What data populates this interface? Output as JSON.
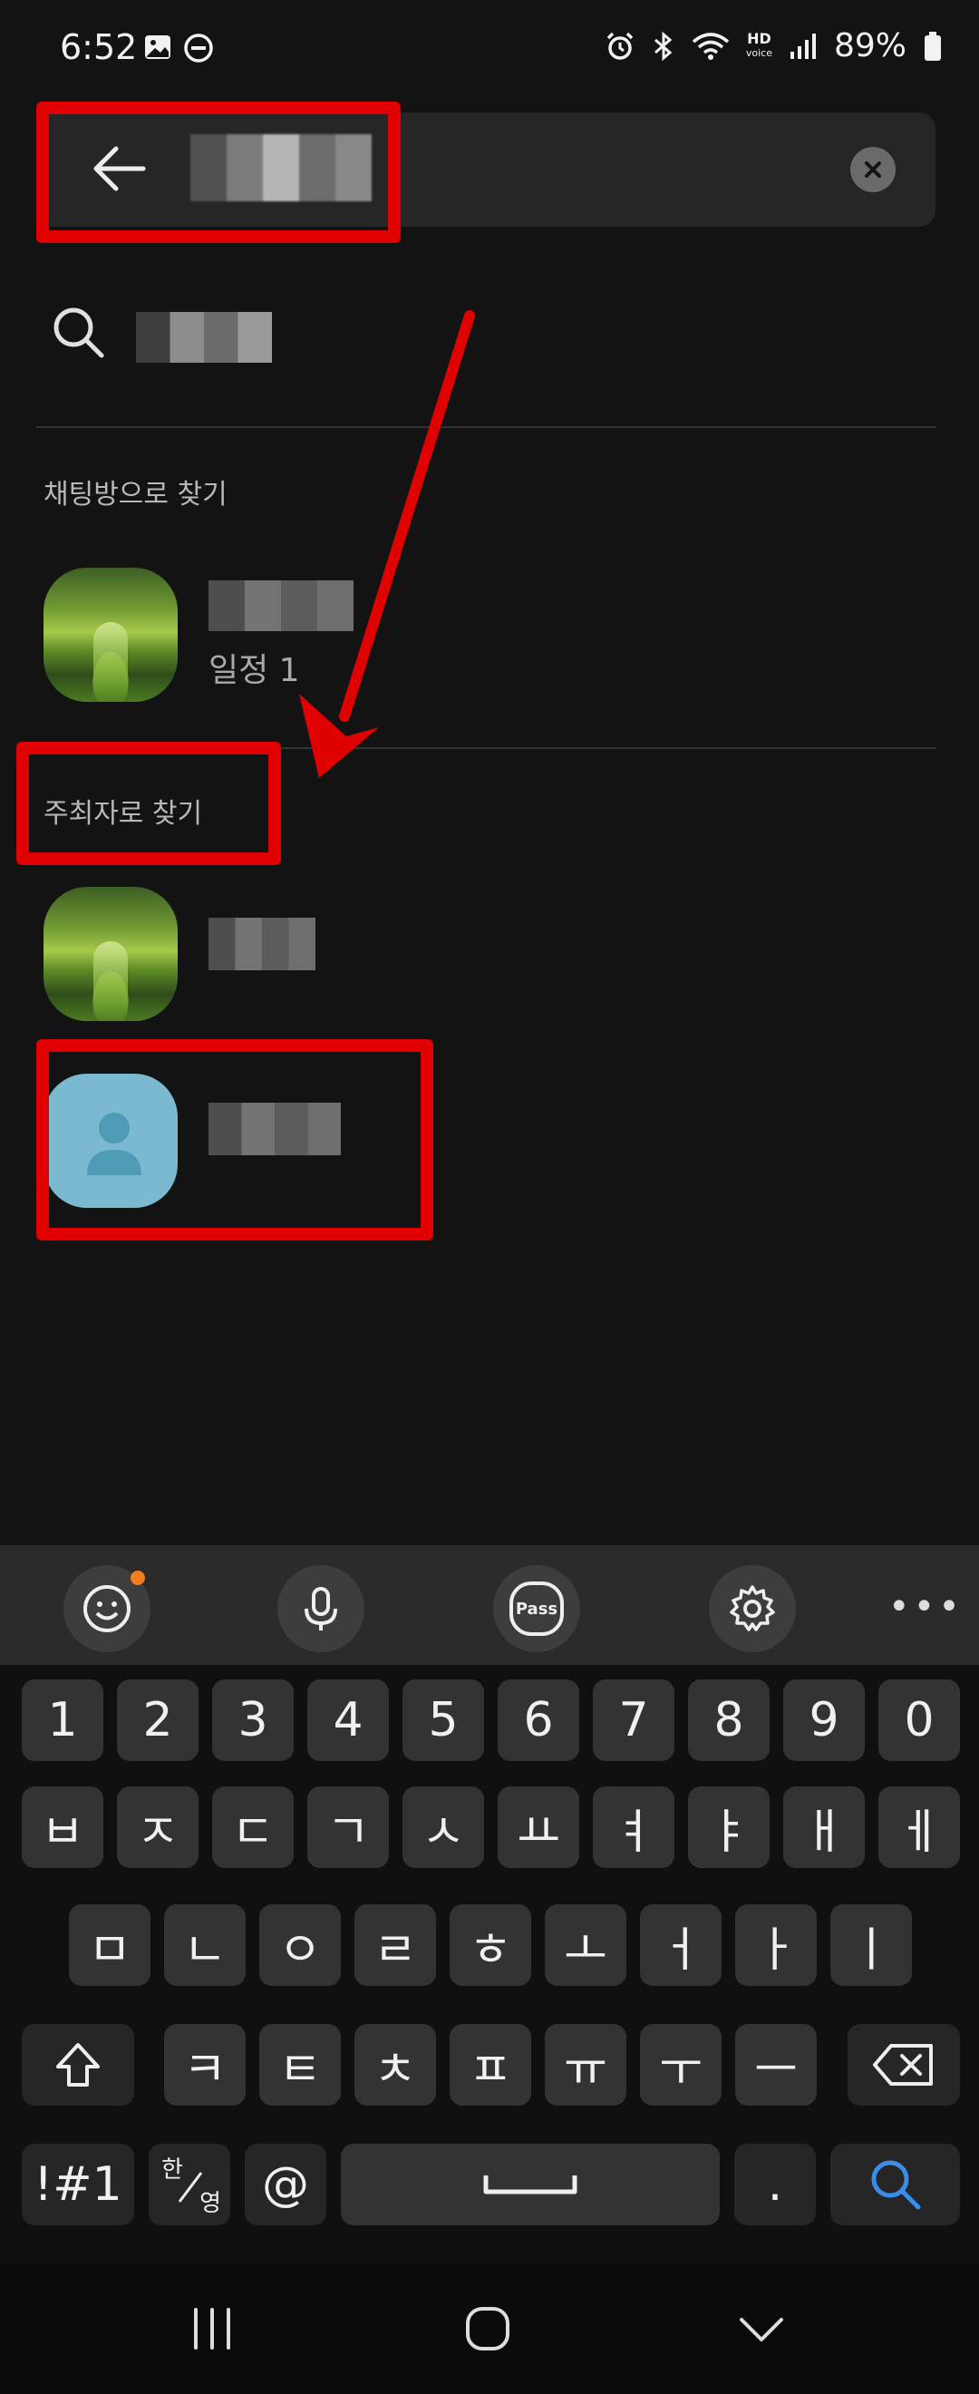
{
  "status_bar": {
    "time": "6:52",
    "hd_label": "HD",
    "hd_sub": "voice",
    "battery": "89%"
  },
  "search": {
    "query": "",
    "clear_icon": "close-circle-icon",
    "back_icon": "arrow-left-icon"
  },
  "suggestion": {
    "icon": "search-icon",
    "text": ""
  },
  "sections": {
    "by_chatroom": {
      "title": "채팅방으로 찾기",
      "items": [
        {
          "name": "",
          "subtitle": "일정 1"
        }
      ]
    },
    "by_host": {
      "title": "주최자로 찾기",
      "items": [
        {
          "name": ""
        },
        {
          "name": ""
        }
      ]
    }
  },
  "keyboard": {
    "toolbar": [
      "emoji-icon",
      "mic-icon",
      "pass-icon",
      "settings-icon",
      "more-icon"
    ],
    "pass_label": "Pass",
    "more_label": "•••",
    "row_numbers": [
      "1",
      "2",
      "3",
      "4",
      "5",
      "6",
      "7",
      "8",
      "9",
      "0"
    ],
    "row_1": [
      "ㅂ",
      "ㅈ",
      "ㄷ",
      "ㄱ",
      "ㅅ",
      "ㅛ",
      "ㅕ",
      "ㅑ",
      "ㅐ",
      "ㅔ"
    ],
    "row_2": [
      "ㅁ",
      "ㄴ",
      "ㅇ",
      "ㄹ",
      "ㅎ",
      "ㅗ",
      "ㅓ",
      "ㅏ",
      "ㅣ"
    ],
    "row_3": [
      "ㅋ",
      "ㅌ",
      "ㅊ",
      "ㅍ",
      "ㅠ",
      "ㅜ",
      "ㅡ"
    ],
    "symbols_label": "!#1",
    "lang_top": "한",
    "lang_bottom": "영",
    "at_label": "@",
    "period_label": "."
  },
  "colors": {
    "annotation": "#e10000",
    "search_key": "#3b8ee8",
    "notification": "#f07d1e"
  }
}
